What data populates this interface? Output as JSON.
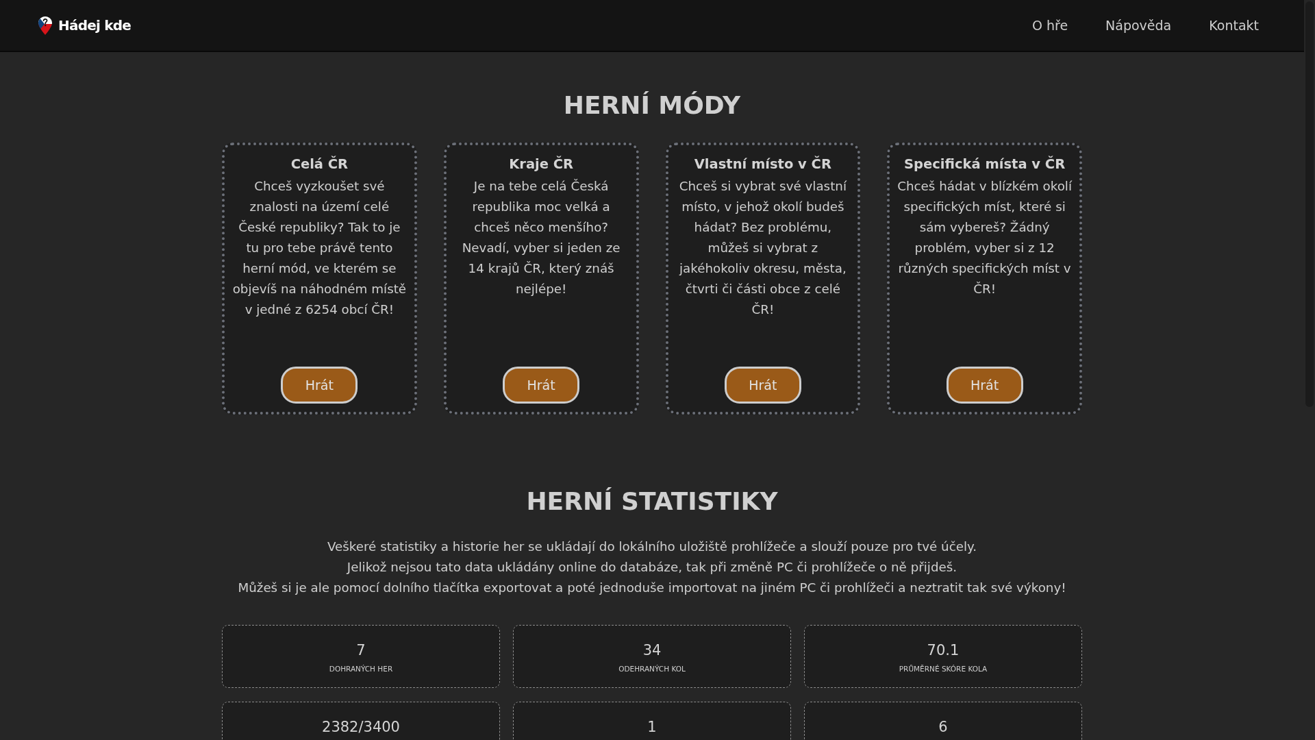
{
  "header": {
    "logo": "Hádej kde",
    "nav": [
      "O hře",
      "Nápověda",
      "Kontakt"
    ]
  },
  "modes": {
    "title": "HERNÍ MÓDY",
    "cards": [
      {
        "title": "Celá ČR",
        "description": "Chceš vyzkoušet své znalosti na území celé České republiky? Tak to je tu pro tebe právě tento herní mód, ve kterém se objevíš na náhodném místě v jedné z 6254 obcí ČR!",
        "button": "Hrát"
      },
      {
        "title": "Kraje ČR",
        "description": "Je na tebe celá Česká republika moc velká a chceš něco menšího? Nevadí, vyber si jeden ze 14 krajů ČR, který znáš nejlépe!",
        "button": "Hrát"
      },
      {
        "title": "Vlastní místo v ČR",
        "description": "Chceš si vybrat své vlastní místo, v jehož okolí budeš hádat? Bez problému, můžeš si vybrat z jakéhokoliv okresu, města, čtvrti či části obce z celé ČR!",
        "button": "Hrát"
      },
      {
        "title": "Specifická místa v ČR",
        "description": "Chceš hádat v blízkém okolí specifických míst, které si sám vybereš? Žádný problém, vyber si z 12 různých specifických míst v ČR!",
        "button": "Hrát"
      }
    ]
  },
  "stats": {
    "title": "HERNÍ STATISTIKY",
    "intro": [
      "Veškeré statistiky a historie her se ukládají do lokálního uložiště prohlížeče a slouží pouze pro tvé účely.",
      "Jelikož nejsou tato data ukládány online do databáze, tak při změně PC či prohlížeče o ně přijdeš.",
      "Můžeš si je ale pomocí dolního tlačítka exportovat a poté jednoduše importovat na jiném PC či prohlížeči a neztratit tak své výkony!"
    ],
    "items": [
      {
        "value": "7",
        "label": "DOHRANÝCH HER"
      },
      {
        "value": "34",
        "label": "ODEHRANÝCH KOL"
      },
      {
        "value": "70.1",
        "label": "PRŮMĚRNÉ SKÓRE KOLA"
      },
      {
        "value": "2382/3400"
      },
      {
        "value": "1"
      },
      {
        "value": "6"
      }
    ]
  }
}
